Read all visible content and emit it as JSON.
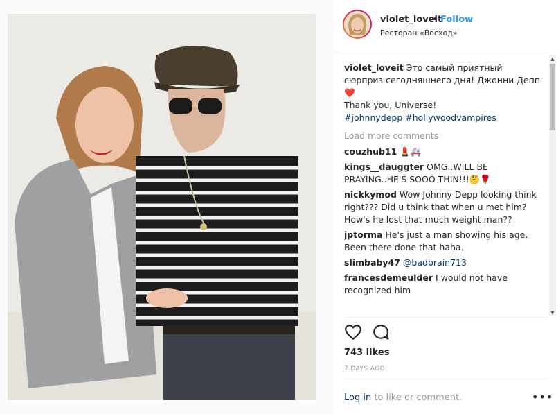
{
  "header": {
    "username": "violet_loveit",
    "separator": "•",
    "follow_label": "Follow",
    "location": "Ресторан «Восход»"
  },
  "caption": {
    "username": "violet_loveit",
    "line1": "Это самый приятный сюрприз сегодняшнего дня! Джонни Депп❤️",
    "line2": "Thank you, Universe!",
    "tags": "#johnnydepp #hollywoodvampires"
  },
  "load_more_label": "Load more comments",
  "comments": [
    {
      "user": "couzhub11",
      "text": "💄🚑"
    },
    {
      "user": "kings__dauggter",
      "text": "OMG..WILL BE PRAYING..HE'S SOOO THIN!!!🤔🌹"
    },
    {
      "user": "nickkymod",
      "text": "Wow Johnny Depp looking think right??? Did u think that when u met him? How's he lost that much weight man??"
    },
    {
      "user": "jptorma",
      "text": "He's just a man showing his age. Been there done that haha."
    },
    {
      "user": "slimbaby47",
      "text": "@badbrain713"
    },
    {
      "user": "francesdemeulder",
      "text": "I would not have recognized him"
    }
  ],
  "likes_label": "743 likes",
  "time_ago": "7 DAYS AGO",
  "login": {
    "link_label": "Log in",
    "rest": "to like or comment."
  },
  "more_label": "•••",
  "icons": {
    "like": "heart-icon",
    "comment": "comment-bubble-icon",
    "options": "more-options-icon"
  },
  "colors": {
    "link_blue": "#3897f0",
    "hashtag": "#003569",
    "muted": "#999999"
  }
}
